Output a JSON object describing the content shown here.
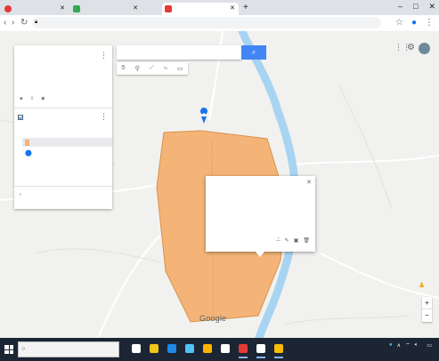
{
  "browser": {
    "tabs": [
      {
        "label": "",
        "favicon_color": "#e53935"
      },
      {
        "label": "",
        "favicon_color": "#34a853"
      },
      {
        "label": "",
        "favicon_color": "#e53935"
      }
    ],
    "new_tab_glyph": "+",
    "url": "",
    "window_controls": [
      "–",
      "□",
      "✕"
    ]
  },
  "map": {
    "search": {
      "placeholder": "",
      "button_icon": "search-icon"
    },
    "tools": [
      "hand-icon",
      "marker-icon",
      "line-icon",
      "directions-icon",
      "ruler-icon"
    ],
    "towns": [
      "",
      "",
      "",
      "",
      "",
      "",
      "",
      "",
      ""
    ],
    "google_logo": "Google",
    "footer": "",
    "colors": {
      "water": "#a8d4f2",
      "polygon": "#f4b477",
      "polygon_border": "#d9924e",
      "road": "#ffffff",
      "accent": "#4285f4"
    },
    "top_right_icons": [
      "apps-icon",
      "settings-icon",
      "avatar"
    ]
  },
  "panel": {
    "title": "",
    "subtitle": "",
    "description": "",
    "actions": [
      {
        "icon": "add-layer-icon",
        "label": ""
      },
      {
        "icon": "share-icon",
        "label": ""
      },
      {
        "icon": "preview-icon",
        "label": ""
      }
    ],
    "layer": {
      "name": "",
      "style_link": "",
      "features": [
        {
          "label": "",
          "color": "#f4b477",
          "selected": true
        },
        {
          "label": "",
          "color": "#1a73e8",
          "selected": false
        }
      ]
    },
    "base_map_label": ""
  },
  "popup": {
    "title": "",
    "line1": "",
    "line2": "",
    "footer_items": [
      "",
      ""
    ],
    "icons": [
      "style-icon",
      "edit-icon",
      "photo-icon",
      "delete-icon"
    ]
  },
  "taskbar": {
    "search_placeholder": "",
    "apps": [
      {
        "name": "task-view",
        "color": "#ffffff"
      },
      {
        "name": "file-explorer",
        "color": "#f0c419"
      },
      {
        "name": "edge",
        "color": "#1e88e5"
      },
      {
        "name": "store",
        "color": "#4fc3f7"
      },
      {
        "name": "app-5",
        "color": "#ffb300"
      },
      {
        "name": "app-6",
        "color": "#ffffff"
      },
      {
        "name": "opera",
        "color": "#e53935"
      },
      {
        "name": "app-8",
        "color": "#ffffff"
      },
      {
        "name": "chrome",
        "color": "#fbbc05"
      }
    ],
    "clock_time": "",
    "clock_date": ""
  }
}
